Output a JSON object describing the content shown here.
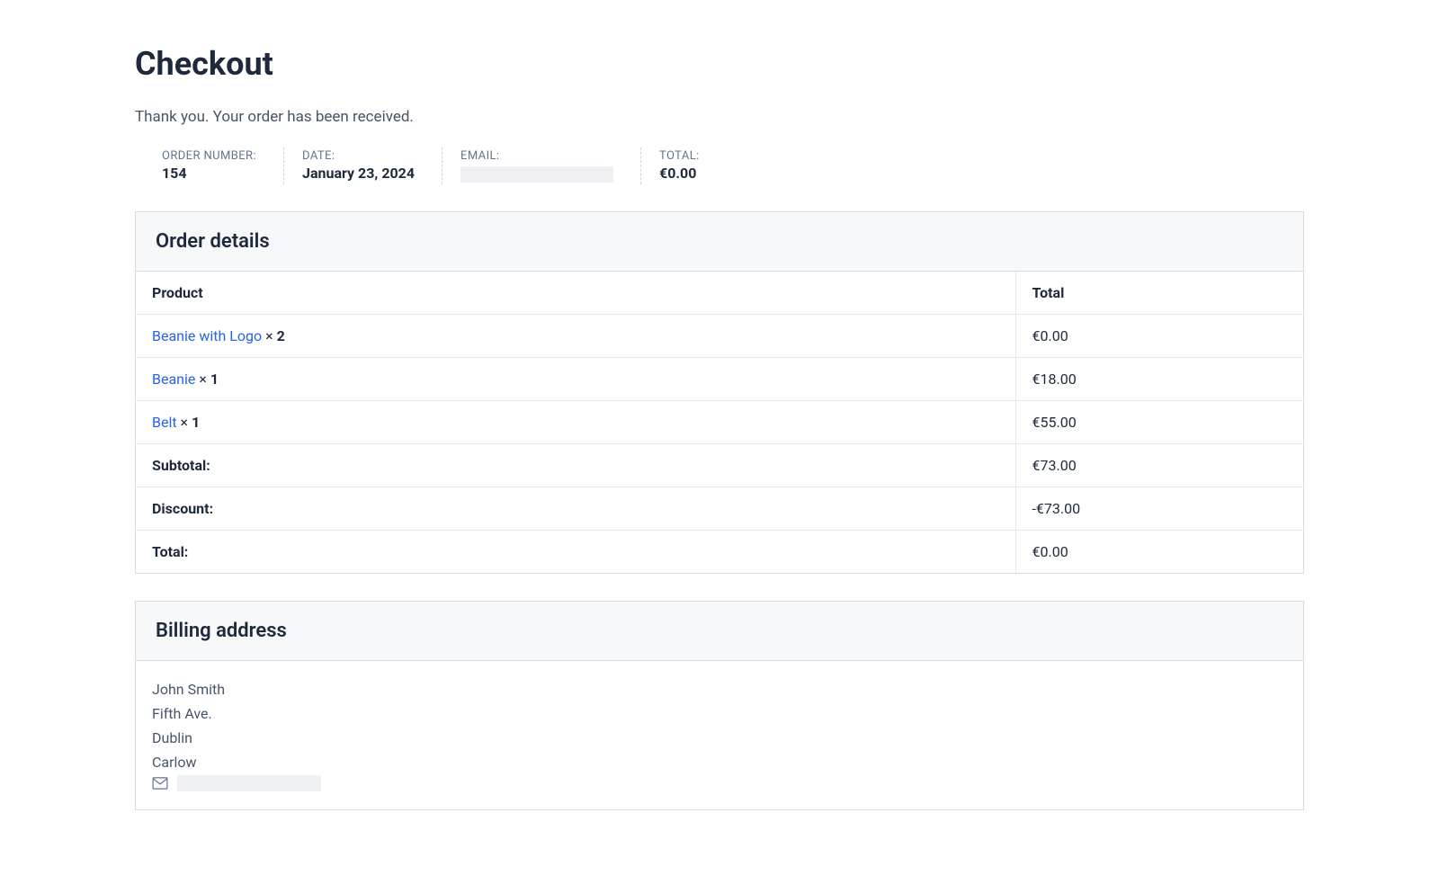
{
  "page": {
    "title": "Checkout",
    "thank_you": "Thank you. Your order has been received."
  },
  "summary": {
    "order_number_label": "ORDER NUMBER:",
    "order_number": "154",
    "date_label": "DATE:",
    "date": "January 23, 2024",
    "email_label": "EMAIL:",
    "total_label": "TOTAL:",
    "total": "€0.00"
  },
  "order_details": {
    "heading": "Order details",
    "columns": {
      "product": "Product",
      "total": "Total"
    },
    "items": [
      {
        "name": "Beanie with Logo",
        "qty": "2",
        "total": "€0.00"
      },
      {
        "name": "Beanie",
        "qty": "1",
        "total": "€18.00"
      },
      {
        "name": "Belt",
        "qty": "1",
        "total": "€55.00"
      }
    ],
    "subtotal_label": "Subtotal:",
    "subtotal": "€73.00",
    "discount_label": "Discount:",
    "discount": "-€73.00",
    "total_label": "Total:",
    "total": "€0.00"
  },
  "billing": {
    "heading": "Billing address",
    "name": "John Smith",
    "street": "Fifth Ave.",
    "city": "Dublin",
    "region": "Carlow"
  }
}
